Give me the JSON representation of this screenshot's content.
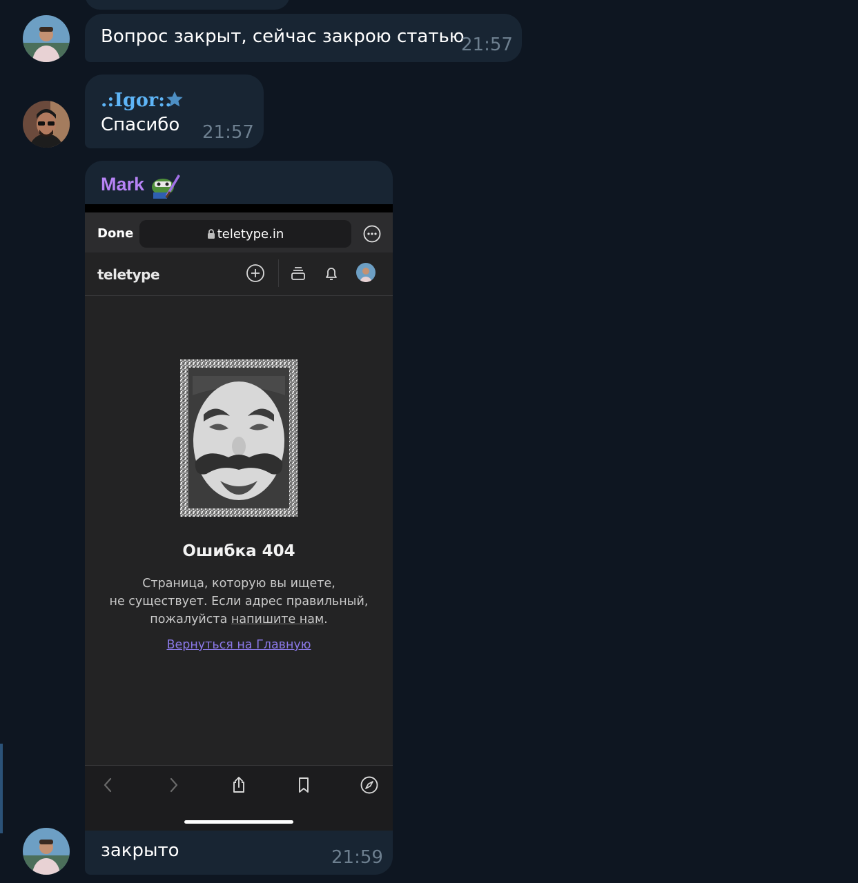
{
  "messages": [
    {
      "text": "Вопрос закрыт, сейчас закрою статью",
      "time": "21:57"
    },
    {
      "sender": ".:Igor:.",
      "sender_color": "#5eb5f7",
      "text": "Спасибо",
      "time": "21:57"
    },
    {
      "sender": "Mark",
      "sender_color": "#b683f5"
    },
    {
      "text": "закрыто",
      "time": "21:59"
    }
  ],
  "screenshot": {
    "done_label": "Done",
    "url": "teletype.in",
    "logo": "teletype",
    "error_title": "Ошибка 404",
    "error_line1": "Страница, которую вы ищете,",
    "error_line2": "не существует. Если адрес правильный,",
    "error_line3_prefix": "пожалуйста ",
    "error_line3_link": "напишите нам",
    "error_line3_suffix": ".",
    "back_link": "Вернуться на Главную"
  },
  "colors": {
    "background": "#0e1621",
    "bubble": "#182533",
    "time": "#6d7f8f",
    "link": "#8a78e6"
  }
}
